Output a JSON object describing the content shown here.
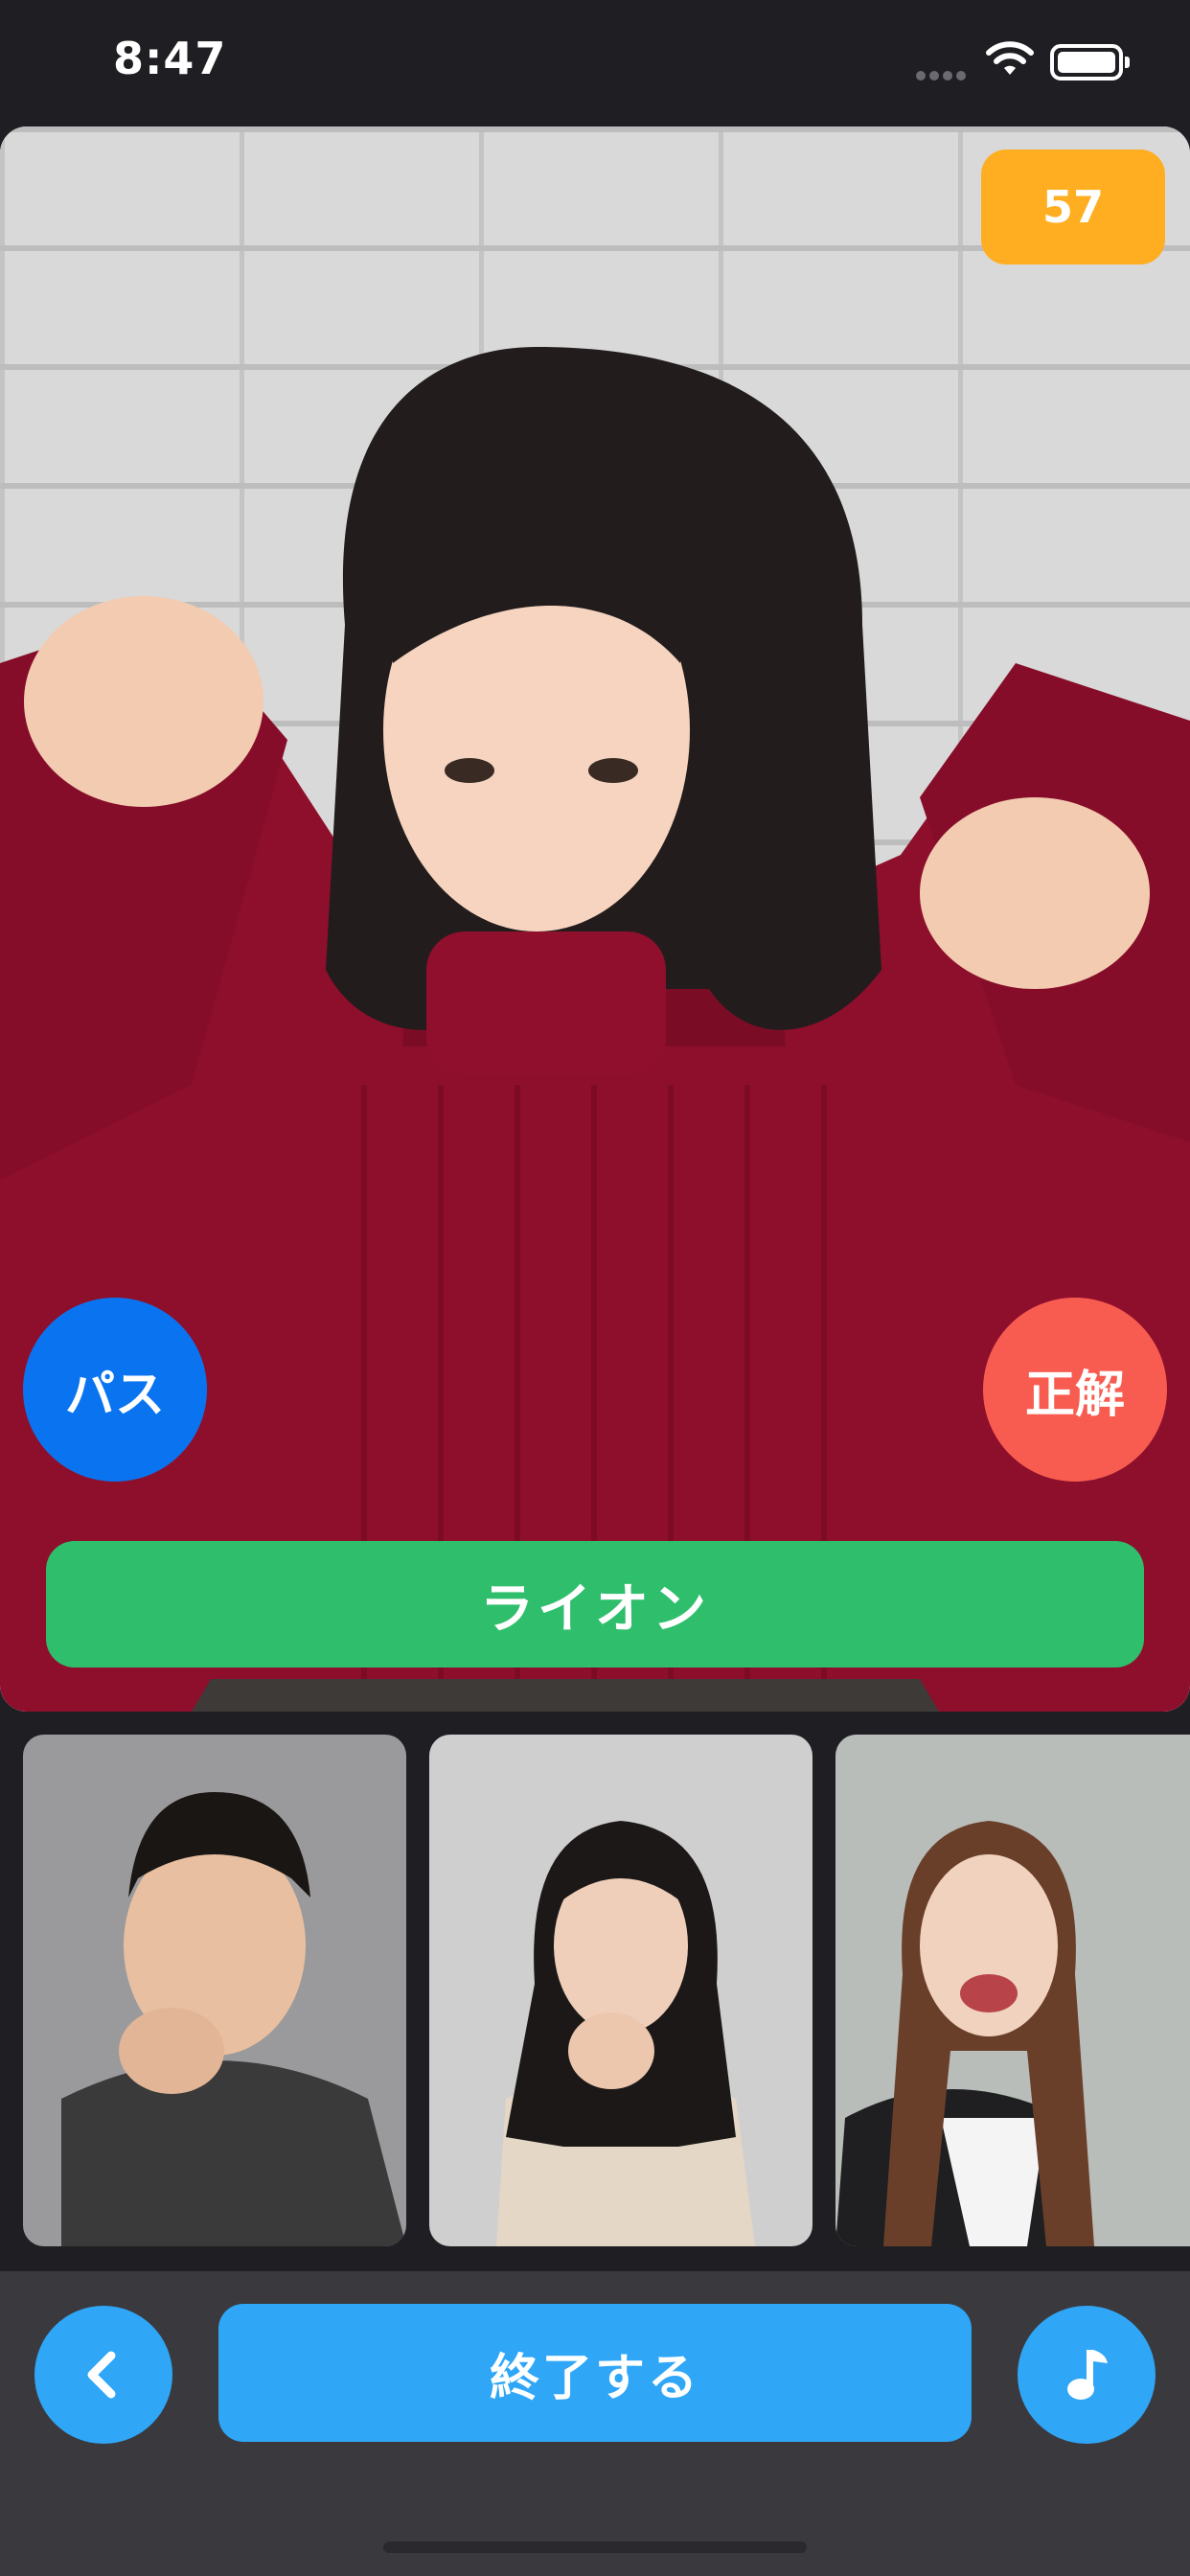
{
  "status_bar": {
    "time": "8:47",
    "icons": [
      "signal-icon",
      "wifi-icon",
      "battery-icon"
    ]
  },
  "game": {
    "timer": "57",
    "pass_label": "パス",
    "correct_label": "正解",
    "answer": "ライオン",
    "current_photo": "woman-claw-pose-photo"
  },
  "thumbnails": [
    {
      "name": "thumbnail-man-pouting"
    },
    {
      "name": "thumbnail-woman-thinking"
    },
    {
      "name": "thumbnail-woman-laughing"
    }
  ],
  "toolbar": {
    "back_icon": "chevron-left-icon",
    "finish_label": "終了する",
    "music_icon": "music-note-icon"
  },
  "colors": {
    "background": "#1f1f23",
    "timer": "#ffae21",
    "pass": "#0a74f0",
    "correct": "#f85c50",
    "answer": "#2fbf6c",
    "toolbar_button": "#30a6f7",
    "toolbar_bg": "#3a3a3e"
  }
}
